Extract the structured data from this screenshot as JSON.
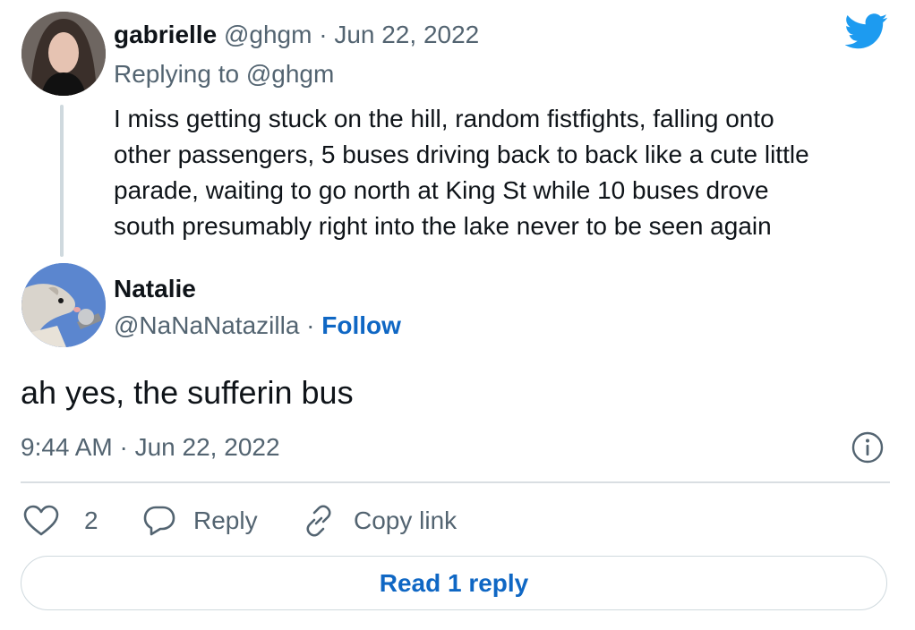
{
  "parent_tweet": {
    "author_name": "gabrielle",
    "author_handle": "@ghgm",
    "separator": "·",
    "date": "Jun 22, 2022",
    "replying_to": "Replying to @ghgm",
    "lines": [
      "I miss getting stuck on the hill, random fistfights, falling onto",
      "other passengers, 5 buses driving back to back like a cute little",
      "parade, waiting to go north at King St while 10 buses drove",
      "south presumably right into the lake never to be seen again"
    ]
  },
  "tweet": {
    "author_name": "Natalie",
    "author_handle": "@NaNaNatazilla",
    "separator": "·",
    "follow_label": "Follow",
    "text": "ah yes, the sufferin bus",
    "timestamp": "9:44 AM · Jun 22, 2022"
  },
  "actions": {
    "like_count": "2",
    "reply_label": "Reply",
    "copy_link_label": "Copy link"
  },
  "read_reply_label": "Read 1 reply",
  "icons": {
    "brand": "twitter-bird-icon",
    "info": "info-icon",
    "like": "heart-icon",
    "reply": "speech-bubble-icon",
    "copy": "link-icon"
  },
  "colors": {
    "brand_blue": "#1d9bf0",
    "link_blue": "#0f67c4",
    "muted_text": "#536471",
    "border": "#cfd9de"
  }
}
